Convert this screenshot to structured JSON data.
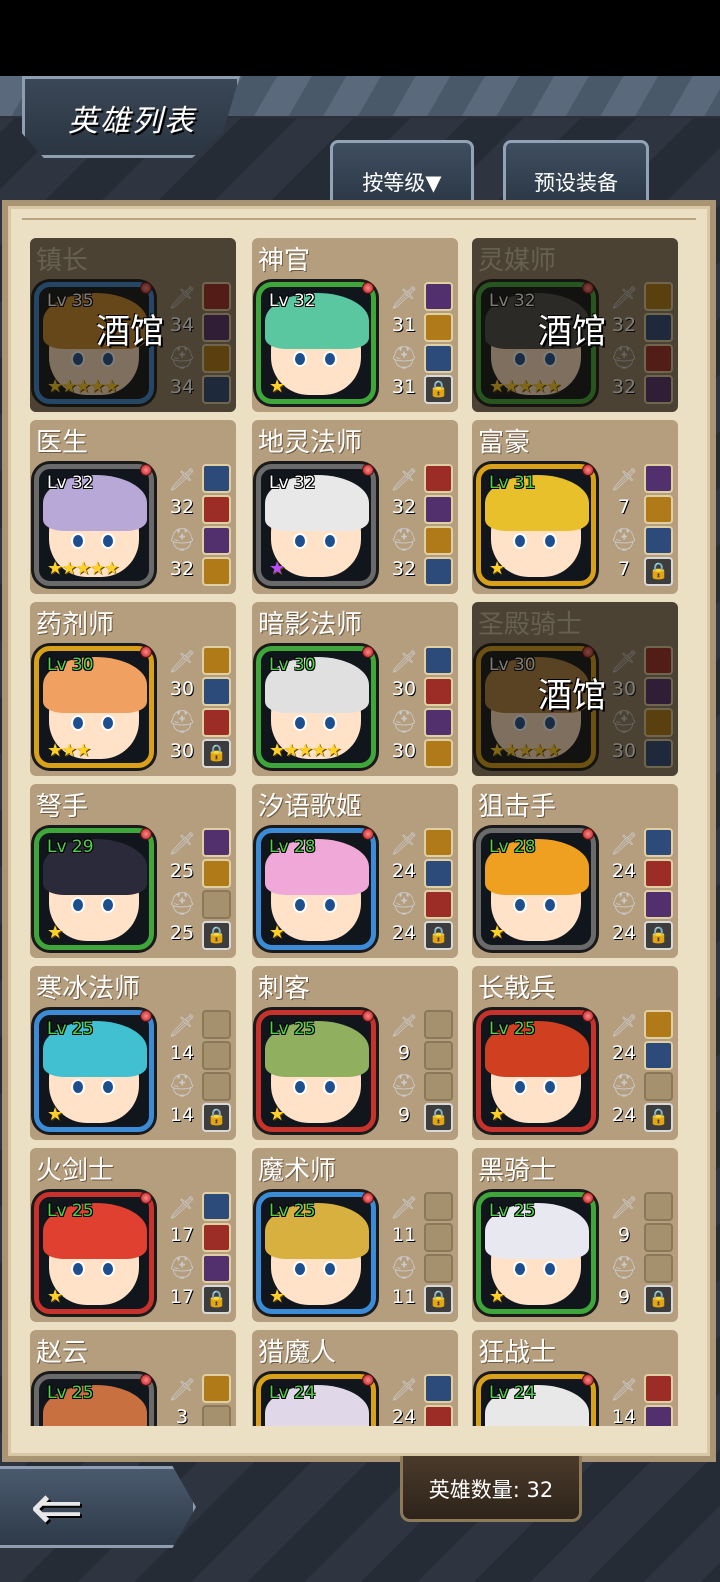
{
  "header": {
    "title": "英雄列表",
    "sort_button": "按等级▼",
    "preset_button": "预设装备"
  },
  "footer": {
    "hero_count_label": "英雄数量: 32",
    "back_icon": "back-arrow-icon"
  },
  "tavern_label": "酒馆",
  "heroes": [
    {
      "name": "镇长",
      "level": "Lv 35",
      "atk": "34",
      "def": "34",
      "stars": 5,
      "frame": "blue",
      "dim": true,
      "tavern": true
    },
    {
      "name": "神官",
      "level": "Lv 32",
      "atk": "31",
      "def": "31",
      "stars": 1,
      "frame": "green",
      "dim": false,
      "tavern": false
    },
    {
      "name": "灵媒师",
      "level": "Lv 32",
      "atk": "32",
      "def": "32",
      "stars": 5,
      "frame": "green",
      "dim": true,
      "tavern": true
    },
    {
      "name": "医生",
      "level": "Lv 32",
      "atk": "32",
      "def": "32",
      "stars": 5,
      "frame": "gray",
      "dim": false,
      "tavern": false
    },
    {
      "name": "地灵法师",
      "level": "Lv 32",
      "atk": "32",
      "def": "32",
      "stars": 1,
      "star_color": "purple",
      "frame": "gray",
      "dim": false,
      "tavern": false
    },
    {
      "name": "富豪",
      "level": "Lv 31",
      "atk": "7",
      "def": "7",
      "stars": 1,
      "frame": "gold",
      "dim": false,
      "tavern": false
    },
    {
      "name": "药剂师",
      "level": "Lv 30",
      "atk": "30",
      "def": "30",
      "stars": 3,
      "frame": "gold",
      "dim": false,
      "tavern": false
    },
    {
      "name": "暗影法师",
      "level": "Lv 30",
      "atk": "30",
      "def": "30",
      "stars": 5,
      "frame": "green",
      "dim": false,
      "tavern": false
    },
    {
      "name": "圣殿骑士",
      "level": "Lv 30",
      "atk": "30",
      "def": "30",
      "stars": 5,
      "frame": "gold",
      "dim": true,
      "tavern": true
    },
    {
      "name": "弩手",
      "level": "Lv 29",
      "atk": "25",
      "def": "25",
      "stars": 1,
      "frame": "green",
      "dim": false,
      "tavern": false
    },
    {
      "name": "汐语歌姬",
      "level": "Lv 28",
      "atk": "24",
      "def": "24",
      "stars": 1,
      "frame": "blue",
      "dim": false,
      "tavern": false
    },
    {
      "name": "狙击手",
      "level": "Lv 28",
      "atk": "24",
      "def": "24",
      "stars": 1,
      "frame": "gray",
      "dim": false,
      "tavern": false
    },
    {
      "name": "寒冰法师",
      "level": "Lv 25",
      "atk": "14",
      "def": "14",
      "stars": 1,
      "frame": "blue",
      "dim": false,
      "tavern": false
    },
    {
      "name": "刺客",
      "level": "Lv 25",
      "atk": "9",
      "def": "9",
      "stars": 1,
      "frame": "red",
      "dim": false,
      "tavern": false
    },
    {
      "name": "长戟兵",
      "level": "Lv 25",
      "atk": "24",
      "def": "24",
      "stars": 1,
      "frame": "red",
      "dim": false,
      "tavern": false
    },
    {
      "name": "火剑士",
      "level": "Lv 25",
      "atk": "17",
      "def": "17",
      "stars": 1,
      "frame": "red",
      "dim": false,
      "tavern": false
    },
    {
      "name": "魔术师",
      "level": "Lv 25",
      "atk": "11",
      "def": "11",
      "stars": 1,
      "frame": "blue",
      "dim": false,
      "tavern": false
    },
    {
      "name": "黑骑士",
      "level": "Lv 25",
      "atk": "9",
      "def": "9",
      "stars": 1,
      "frame": "green",
      "dim": false,
      "tavern": false
    },
    {
      "name": "赵云",
      "level": "Lv 25",
      "atk": "3",
      "def": "",
      "stars": 0,
      "frame": "gray",
      "dim": false,
      "tavern": false
    },
    {
      "name": "猎魔人",
      "level": "Lv 24",
      "atk": "24",
      "def": "",
      "stars": 0,
      "frame": "gold",
      "dim": false,
      "tavern": false
    },
    {
      "name": "狂战士",
      "level": "Lv 24",
      "atk": "14",
      "def": "",
      "stars": 0,
      "frame": "gold",
      "dim": false,
      "tavern": false
    }
  ],
  "colors": {
    "panel_bg": "#ece0c4",
    "card_bg": "#b59e7e",
    "level_high": "#4fd14b",
    "star": "#ffd02a"
  }
}
